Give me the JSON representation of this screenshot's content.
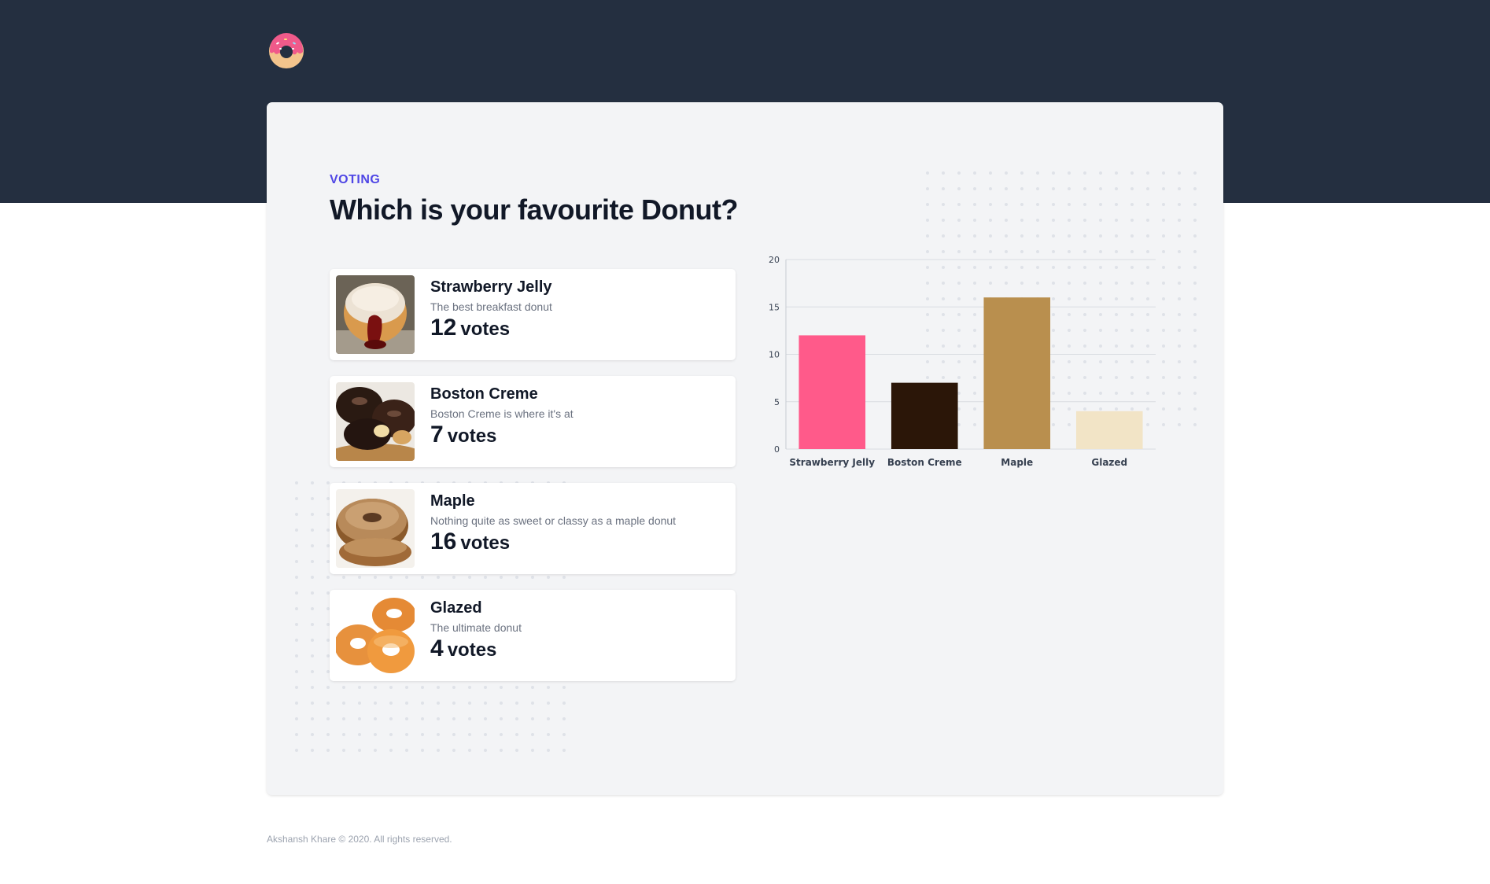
{
  "header": {
    "logo_icon": "donut-icon"
  },
  "page": {
    "eyebrow": "VOTING",
    "title": "Which is your favourite Donut?"
  },
  "donuts": [
    {
      "name": "Strawberry Jelly",
      "description": "The best breakfast donut",
      "votes": "12",
      "votes_unit": "votes",
      "image": "strawberry-jelly-donut-image"
    },
    {
      "name": "Boston Creme",
      "description": "Boston Creme is where it's at",
      "votes": "7",
      "votes_unit": "votes",
      "image": "boston-creme-donut-image"
    },
    {
      "name": "Maple",
      "description": "Nothing quite as sweet or classy as a maple donut",
      "votes": "16",
      "votes_unit": "votes",
      "image": "maple-donut-image"
    },
    {
      "name": "Glazed",
      "description": "The ultimate donut",
      "votes": "4",
      "votes_unit": "votes",
      "image": "glazed-donut-image"
    }
  ],
  "chart_data": {
    "type": "bar",
    "categories": [
      "Strawberry Jelly",
      "Boston Creme",
      "Maple",
      "Glazed"
    ],
    "values": [
      12,
      7,
      16,
      4
    ],
    "colors": [
      "#ff5a8a",
      "#2b1608",
      "#b98f4e",
      "#f2e4c6"
    ],
    "yticks": [
      0,
      5,
      10,
      15,
      20
    ],
    "ylim": [
      0,
      20
    ],
    "grid": true,
    "title": "",
    "xlabel": "",
    "ylabel": ""
  },
  "footer": {
    "text": "Akshansh Khare © 2020. All rights reserved."
  },
  "colors": {
    "header_bg": "#242f40",
    "card_bg": "#f3f4f6",
    "accent": "#4f46e5"
  }
}
